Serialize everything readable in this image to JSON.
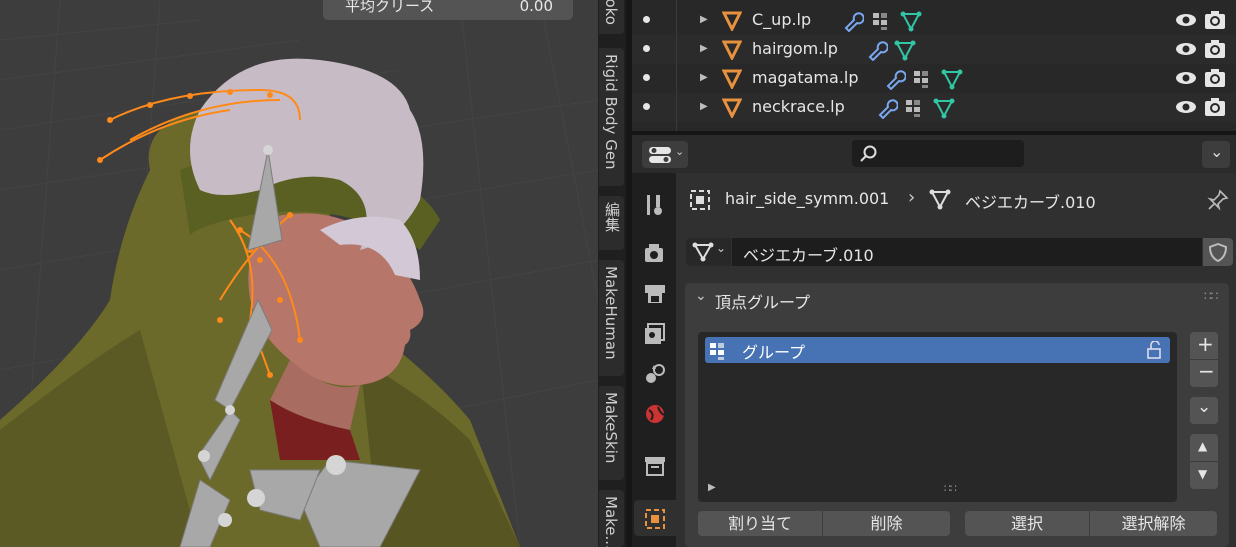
{
  "viewport": {
    "field_label": "平均クリース",
    "field_value": "0.00"
  },
  "sidebar_tabs": [
    "...koko",
    "Rigid Body Gen",
    "編集",
    "MakeHuman",
    "MakeSkin",
    "Make..."
  ],
  "outliner": {
    "rows": [
      {
        "name": "C_up.lp"
      },
      {
        "name": "hairgom.lp"
      },
      {
        "name": "magatama.lp"
      },
      {
        "name": "neckrace.lp"
      }
    ]
  },
  "properties": {
    "breadcrumb": {
      "object": "hair_side_symm.001",
      "data": "ベジエカーブ.010"
    },
    "data_name": "ベジエカーブ.010",
    "panel_title": "頂点グループ",
    "groups": [
      {
        "name": "グループ"
      }
    ],
    "buttons": {
      "assign": "割り当て",
      "remove": "削除",
      "select": "選択",
      "deselect": "選択解除"
    }
  },
  "colors": {
    "accent": "#4772b3",
    "selection": "#ff8a1a",
    "curve_icon": "#31c6a4"
  }
}
